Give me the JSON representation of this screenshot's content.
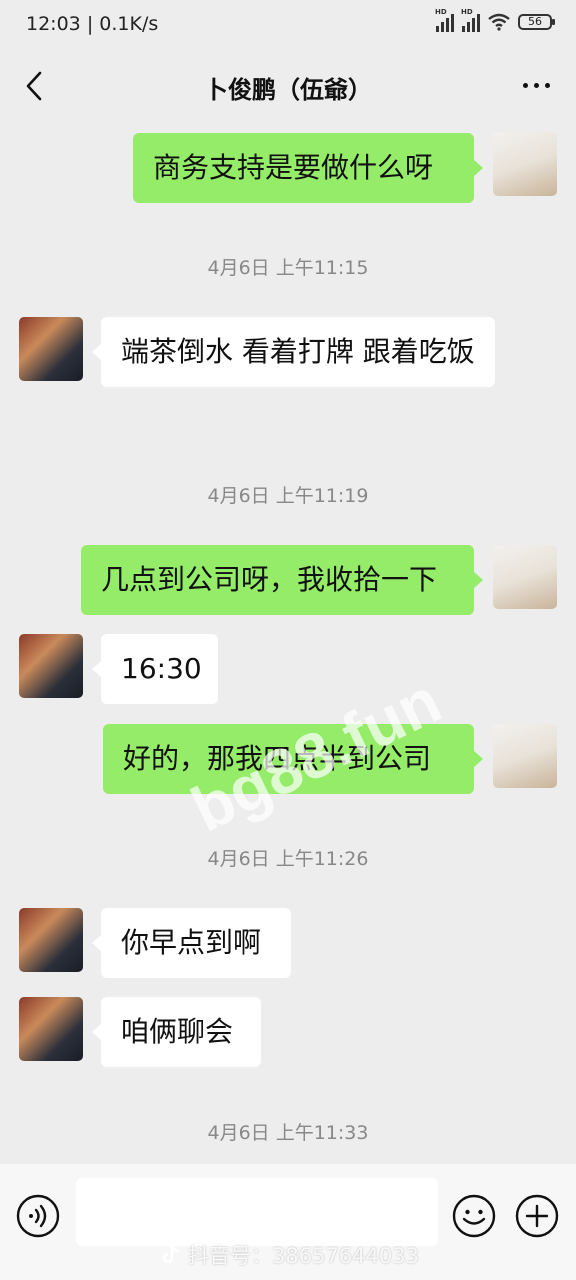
{
  "status_bar": {
    "time": "12:03",
    "speed": "0.1K/s",
    "battery": "56",
    "signal_label": "HD"
  },
  "nav": {
    "title": "卜俊鹏（伍爺）"
  },
  "messages": [
    {
      "side": "right",
      "text": "商务支持是要做什么呀"
    },
    {
      "timestamp": "4月6日 上午11:15"
    },
    {
      "side": "left",
      "text": "端茶倒水 看着打牌 跟着吃饭"
    },
    {
      "timestamp": "4月6日 上午11:19"
    },
    {
      "side": "right",
      "text": "几点到公司呀，我收拾一下"
    },
    {
      "side": "left",
      "text": "16:30"
    },
    {
      "side": "right",
      "text": "好的，那我四点半到公司"
    },
    {
      "timestamp": "4月6日 上午11:26"
    },
    {
      "side": "left",
      "text": "你早点到啊"
    },
    {
      "side": "left",
      "text": "咱俩聊会"
    },
    {
      "timestamp": "4月6日 上午11:33"
    }
  ],
  "watermark": "bg88.fun",
  "tiktok_watermark": "抖音号：38657644033",
  "input": {
    "value": "",
    "placeholder": ""
  },
  "icons": {
    "back": "chevron-left-icon",
    "more": "more-dots-icon",
    "voice": "voice-icon",
    "emoji": "emoji-icon",
    "plus": "plus-icon"
  },
  "colors": {
    "bubble_sent": "#95ec69",
    "bubble_received": "#ffffff",
    "background": "#ededed"
  }
}
